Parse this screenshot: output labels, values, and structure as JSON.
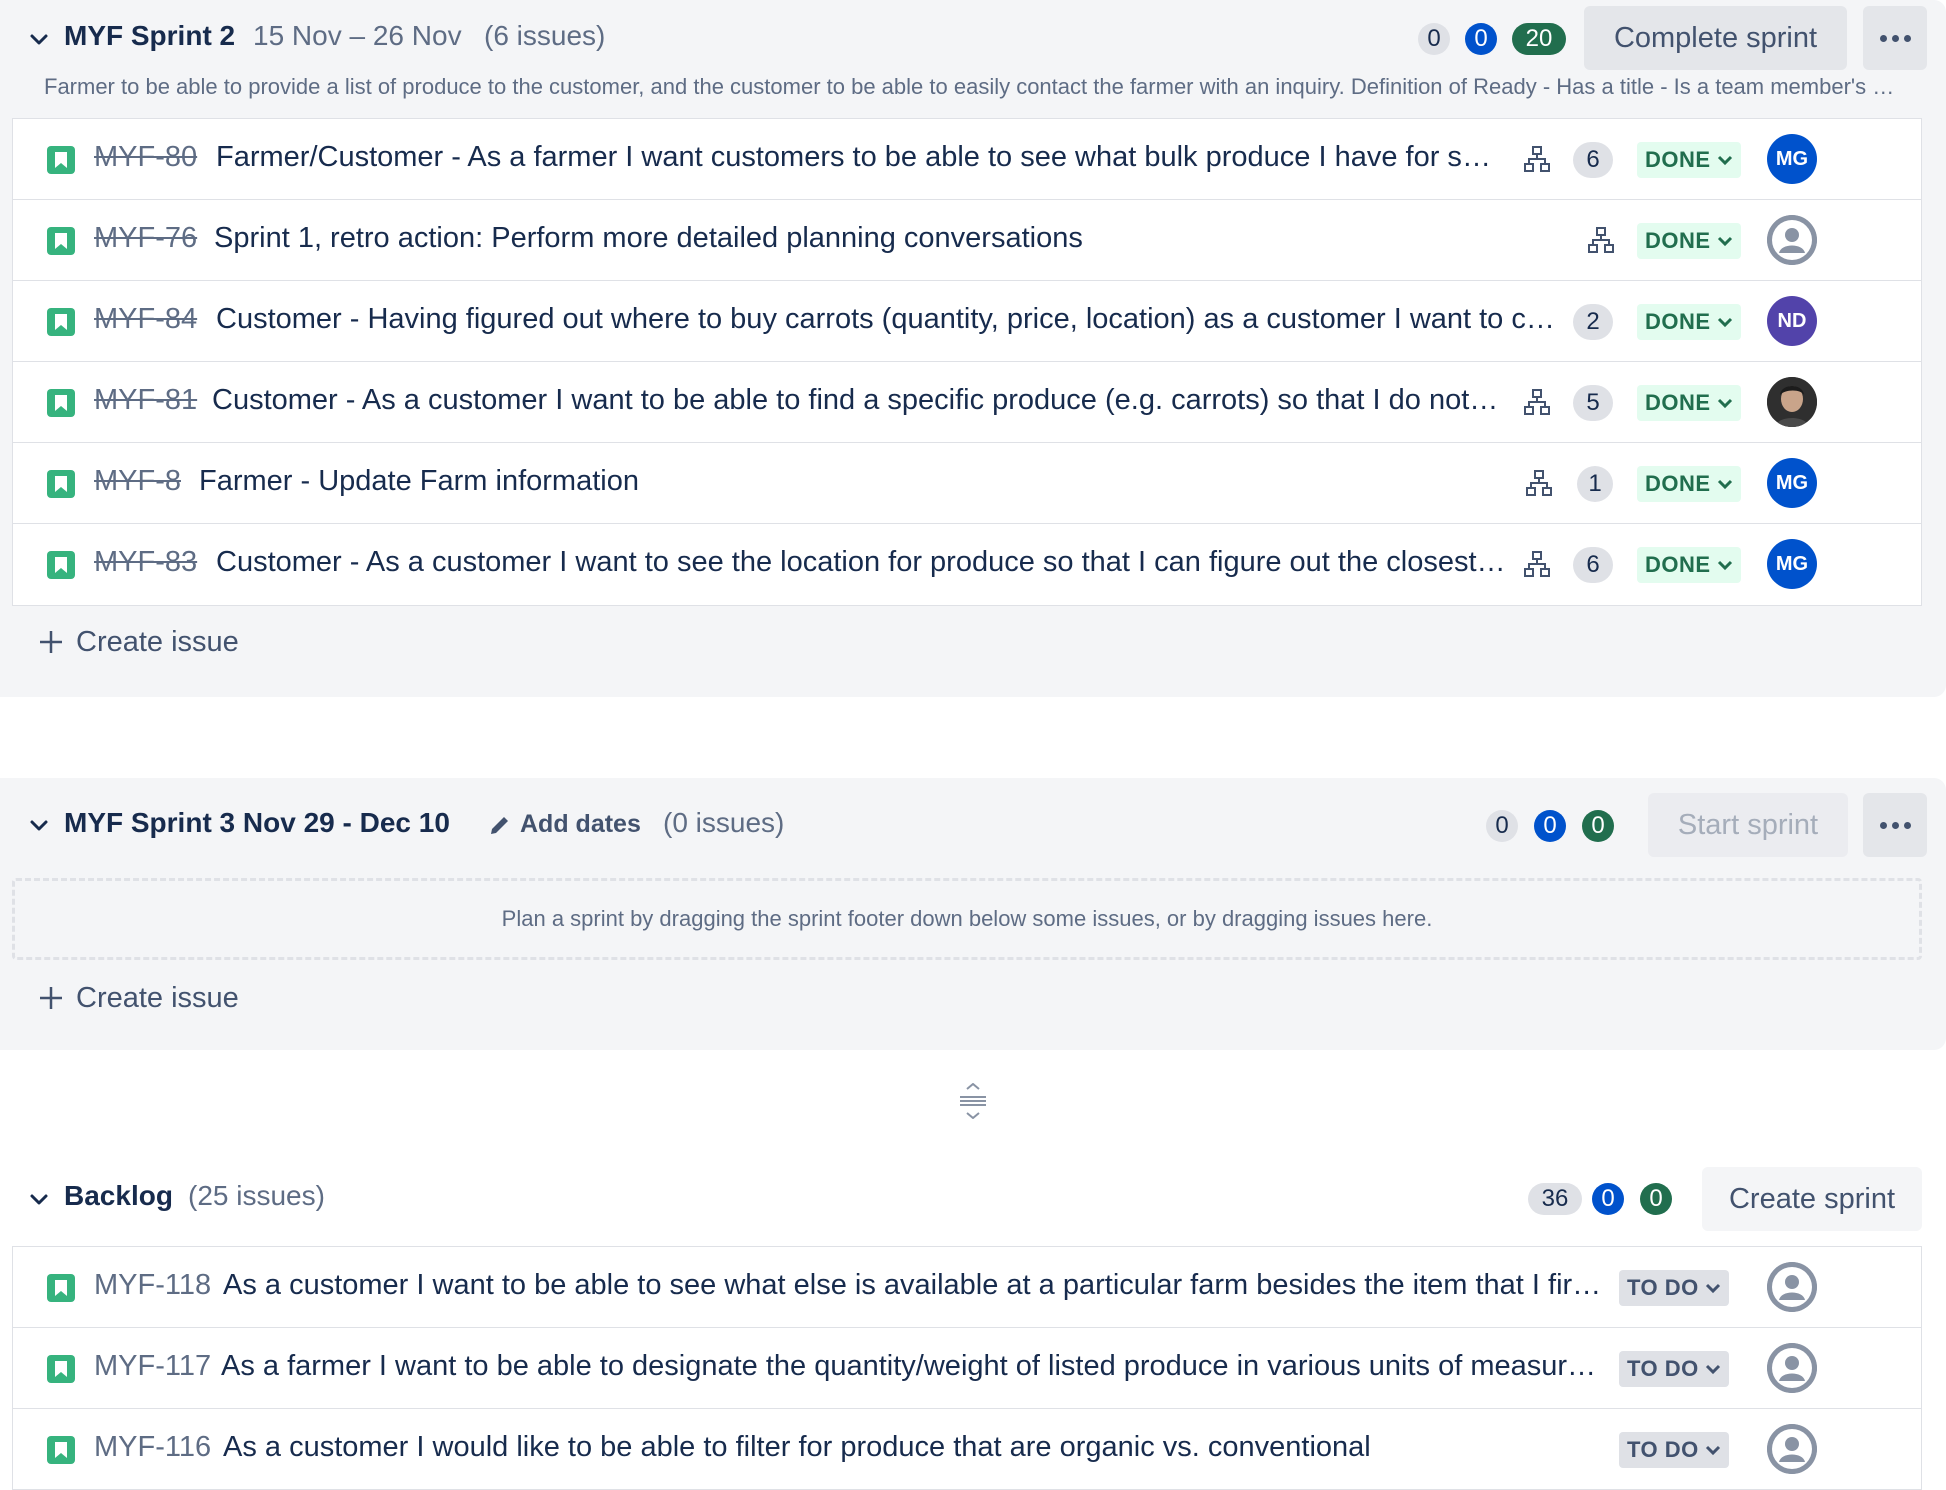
{
  "sprint2": {
    "title": "MYF Sprint 2",
    "dates": "15 Nov – 26 Nov",
    "count": "(6 issues)",
    "pills": [
      "0",
      "0",
      "20"
    ],
    "action_label": "Complete sprint",
    "goal": "Farmer to be able to provide a list of produce to the customer, and the customer to be able to easily contact the farmer with an inquiry. Definition of Ready - Has a title - Is a team member's story",
    "issues": [
      {
        "key": "MYF-80",
        "summary": "Farmer/Customer - As a farmer I want customers to be able to see what bulk produce I have for sale so that I can sell it",
        "estimate": "6",
        "status": "DONE",
        "assignee": "MG"
      },
      {
        "key": "MYF-76",
        "summary": "Sprint 1, retro action: Perform more detailed planning conversations",
        "estimate": "",
        "status": "DONE",
        "assignee": ""
      },
      {
        "key": "MYF-84",
        "summary": "Customer - Having figured out where to buy carrots (quantity, price, location) as a customer I want to contact the farmer",
        "estimate": "2",
        "status": "DONE",
        "assignee": "ND"
      },
      {
        "key": "MYF-81",
        "summary": "Customer - As a customer I want to be able to find a specific produce (e.g. carrots) so that I do not have to scroll",
        "estimate": "5",
        "status": "DONE",
        "assignee": ""
      },
      {
        "key": "MYF-8",
        "summary": "Farmer - Update Farm information",
        "estimate": "1",
        "status": "DONE",
        "assignee": "MG"
      },
      {
        "key": "MYF-83",
        "summary": "Customer - As a customer I want to see the location for produce so that I can figure out the closest farm",
        "estimate": "6",
        "status": "DONE",
        "assignee": "MG"
      }
    ],
    "create_label": "Create issue"
  },
  "sprint3": {
    "title": "MYF Sprint 3 Nov 29 - Dec 10",
    "add_dates": "Add dates",
    "count": "(0 issues)",
    "pills": [
      "0",
      "0",
      "0"
    ],
    "action_label": "Start sprint",
    "empty_text": "Plan a sprint by dragging the sprint footer down below some issues, or by dragging issues here.",
    "create_label": "Create issue"
  },
  "backlog": {
    "title": "Backlog",
    "count": "(25 issues)",
    "pills": [
      "36",
      "0",
      "0"
    ],
    "action_label": "Create sprint",
    "issues": [
      {
        "key": "MYF-118",
        "summary": "As a customer I want to be able to see what else is available at a particular farm besides the item that I first searched for",
        "status": "TO DO"
      },
      {
        "key": "MYF-117",
        "summary": "As a farmer I want to be able to designate the quantity/weight of listed produce in various units of measurement",
        "status": "TO DO"
      },
      {
        "key": "MYF-116",
        "summary": "As a customer I would like to be able to filter for produce that are organic vs. conventional",
        "status": "TO DO"
      }
    ]
  },
  "colors": {
    "done_bg": "#e3fcef",
    "done_text": "#216e4e",
    "todo_bg": "#dfe1e6",
    "todo_text": "#42526e",
    "story_icon": "#36b37e",
    "blue_pill": "#0052cc",
    "green_pill": "#216e4e"
  },
  "icons": [
    "chevron-down-icon",
    "story-icon",
    "hierarchy-icon",
    "more-icon",
    "plus-icon",
    "pencil-icon",
    "drag-handle-icon",
    "avatar-placeholder-icon"
  ]
}
